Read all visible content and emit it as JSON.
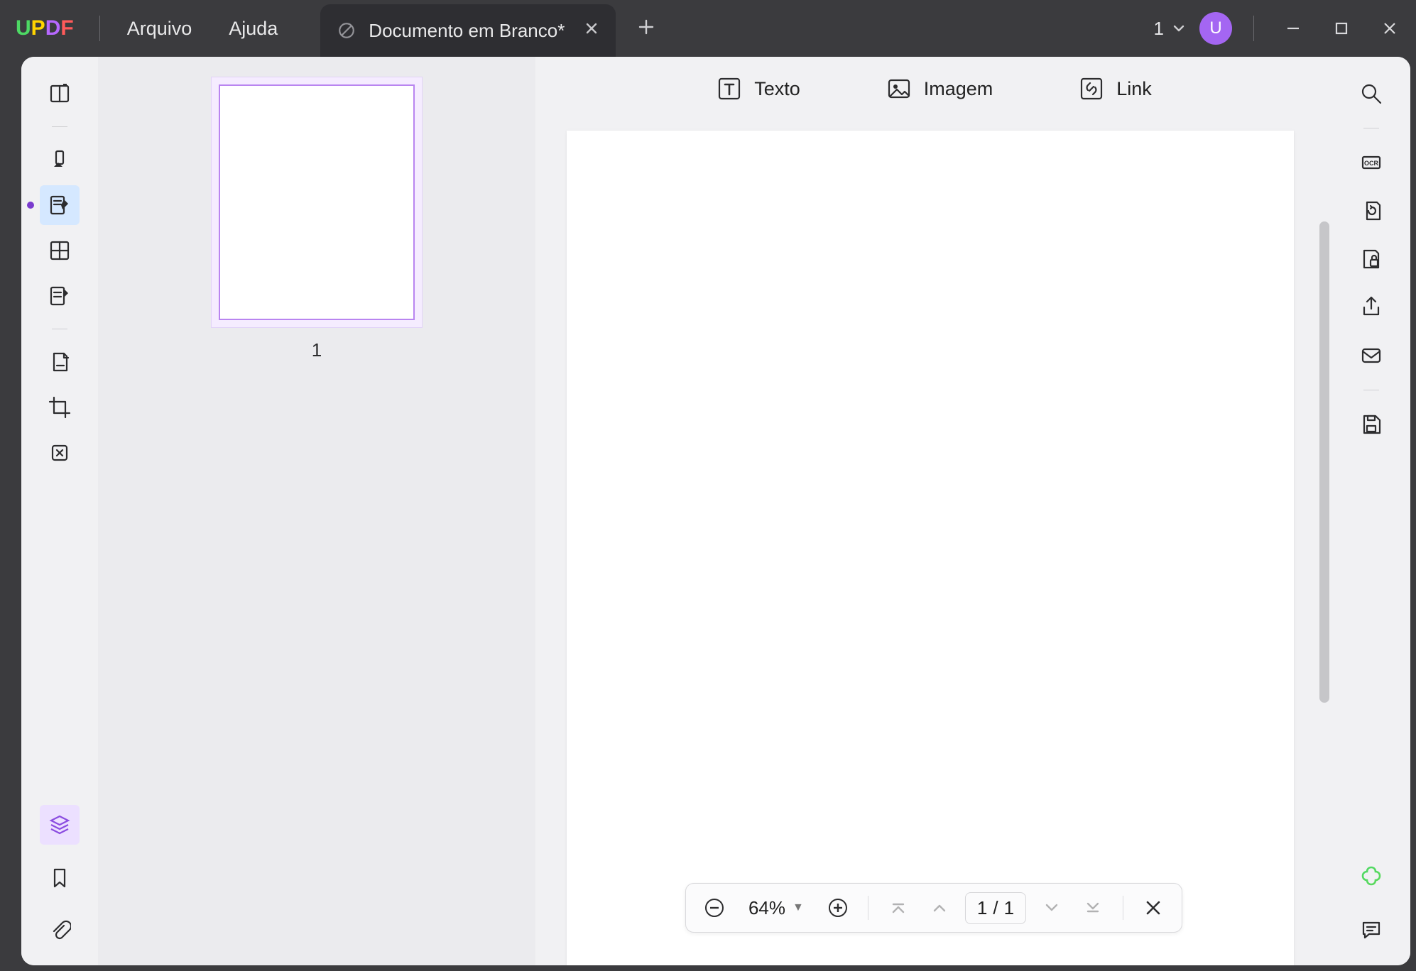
{
  "logo": {
    "u": "U",
    "p": "P",
    "d": "D",
    "f": "F"
  },
  "menu": {
    "file": "Arquivo",
    "help": "Ajuda"
  },
  "tab": {
    "title": "Documento em Branco*"
  },
  "tab_counter": {
    "count": "1"
  },
  "avatar": {
    "initial": "U"
  },
  "thumbnails": {
    "page1_label": "1"
  },
  "insert": {
    "text": "Texto",
    "image": "Imagem",
    "link": "Link"
  },
  "zoom": {
    "value": "64%"
  },
  "paging": {
    "current": "1",
    "sep": "/",
    "total": "1"
  }
}
